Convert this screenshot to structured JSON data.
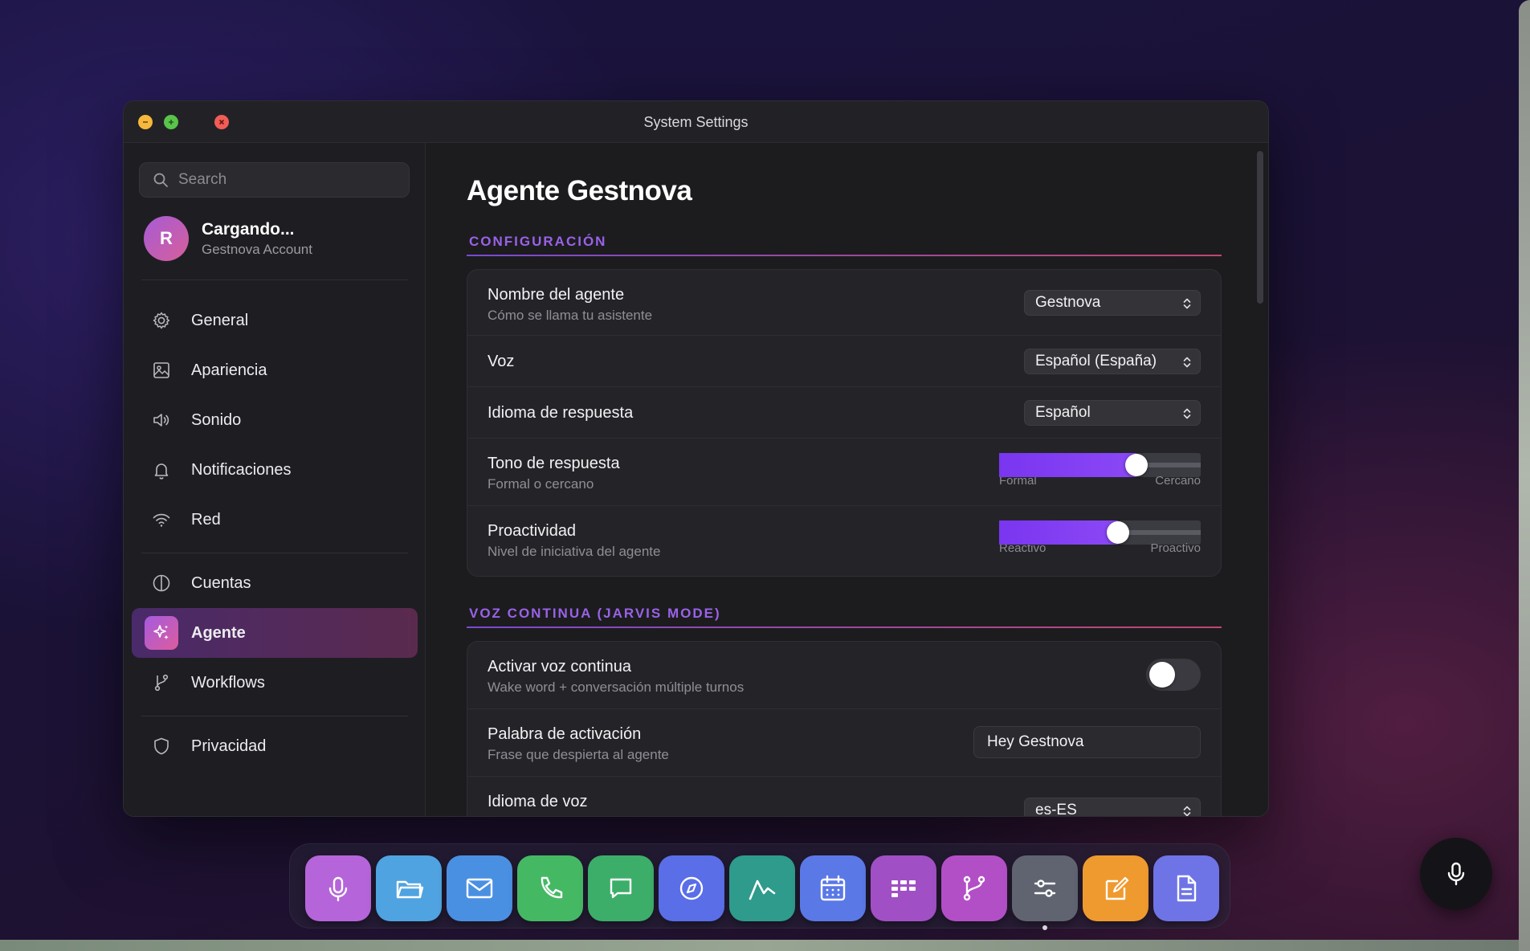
{
  "window": {
    "title": "System Settings"
  },
  "sidebar": {
    "search_placeholder": "Search",
    "profile": {
      "initial": "R",
      "name": "Cargando...",
      "account": "Gestnova Account"
    },
    "items": [
      {
        "label": "General",
        "icon": "gear-icon"
      },
      {
        "label": "Apariencia",
        "icon": "image-icon"
      },
      {
        "label": "Sonido",
        "icon": "speaker-icon"
      },
      {
        "label": "Notificaciones",
        "icon": "bell-icon"
      },
      {
        "label": "Red",
        "icon": "wifi-icon"
      },
      {
        "label": "Cuentas",
        "icon": "half-circle-icon"
      },
      {
        "label": "Agente",
        "icon": "sparkle-icon",
        "active": true
      },
      {
        "label": "Workflows",
        "icon": "branch-icon"
      },
      {
        "label": "Privacidad",
        "icon": "shield-icon"
      }
    ]
  },
  "main": {
    "title": "Agente Gestnova",
    "sections": {
      "config": {
        "title": "CONFIGURACIÓN",
        "agent_name": {
          "label": "Nombre del agente",
          "sub": "Cómo se llama tu asistente",
          "value": "Gestnova"
        },
        "voice": {
          "label": "Voz",
          "value": "Español (España)"
        },
        "response_language": {
          "label": "Idioma de respuesta",
          "value": "Español"
        },
        "tone": {
          "label": "Tono de respuesta",
          "sub": "Formal o cercano",
          "min_label": "Formal",
          "max_label": "Cercano",
          "level": 0.68
        },
        "proactivity": {
          "label": "Proactividad",
          "sub": "Nivel de iniciativa del agente",
          "min_label": "Reactivo",
          "max_label": "Proactivo",
          "level": 0.59
        }
      },
      "continuous": {
        "title": "VOZ CONTINUA (JARVIS MODE)",
        "activate": {
          "label": "Activar voz continua",
          "sub": "Wake word + conversación múltiple turnos",
          "enabled": false
        },
        "wake_word": {
          "label": "Palabra de activación",
          "sub": "Frase que despierta al agente",
          "value": "Hey Gestnova"
        },
        "voice_language": {
          "label": "Idioma de voz",
          "value": "es-ES"
        }
      }
    }
  },
  "dock": {
    "apps": [
      {
        "icon": "microphone-icon",
        "color": "#b565d9"
      },
      {
        "icon": "folder-icon",
        "color": "#4fa3e0"
      },
      {
        "icon": "mail-icon",
        "color": "#4a90e2"
      },
      {
        "icon": "phone-icon",
        "color": "#45b864"
      },
      {
        "icon": "chat-icon",
        "color": "#3cae69"
      },
      {
        "icon": "compass-icon",
        "color": "#5a6ee8"
      },
      {
        "icon": "chart-line-icon",
        "color": "#2e9b8c"
      },
      {
        "icon": "calendar-icon",
        "color": "#5a78e6"
      },
      {
        "icon": "kanban-icon",
        "color": "#a14fc4"
      },
      {
        "icon": "git-branch-icon",
        "color": "#b34fc6"
      },
      {
        "icon": "sliders-icon",
        "color": "#5f6470"
      },
      {
        "icon": "notes-icon",
        "color": "#ef9a2e"
      },
      {
        "icon": "document-icon",
        "color": "#6e74e6"
      }
    ]
  },
  "colors": {
    "accent": "#8b48f5",
    "section_title": "#9a62e8"
  }
}
